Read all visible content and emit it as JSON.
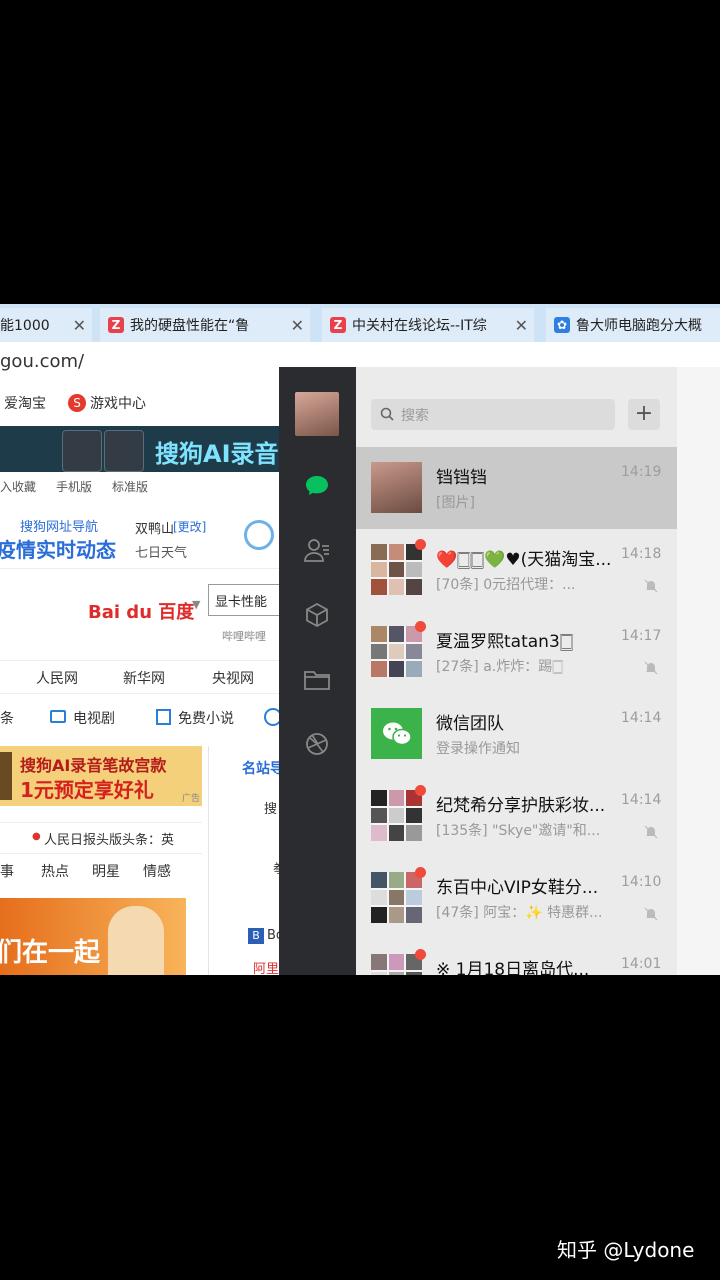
{
  "browser": {
    "tabs": [
      {
        "label": "能1000",
        "icon": "ie-tab-icon"
      },
      {
        "label": "我的硬盘性能在“鲁",
        "icon": "z-logo-icon"
      },
      {
        "label": "中关村在线论坛--IT综",
        "icon": "z-logo-icon"
      },
      {
        "label": "鲁大师电脑跑分大概",
        "icon": "paw-logo-icon"
      }
    ],
    "url": "gou.com/"
  },
  "webpage": {
    "top_links": [
      "爱淘宝",
      "游戏中心"
    ],
    "banner_text": "搜狗AI录音",
    "sub_links": [
      "加入收藏",
      "手机版",
      "标准版"
    ],
    "news_nav_label": "搜狗网址导航",
    "news_headline": "疫情实时动态",
    "weather_city": "双鸭山",
    "weather_change": "[更改]",
    "weather_label": "七日天气",
    "baidu_logo": "Bai du 百度",
    "search_value": "显卡性能",
    "search_hint": "哔哩哔哩",
    "site_links": [
      "人民网",
      "新华网",
      "央视网"
    ],
    "categories": [
      "条",
      "电视剧",
      "免费小说"
    ],
    "ad_line1": "搜狗AI录音笔故宫款",
    "ad_line2": "1元预定享好礼",
    "ad_tag": "广告",
    "right_tab": "名站导",
    "right_text": [
      "搜",
      "拳"
    ],
    "headline_ticker": "人民日报头版头条：英",
    "topic_tabs": [
      "军事",
      "热点",
      "明星",
      "情感"
    ],
    "image_caption": "们在一起",
    "right_items": [
      "Bo",
      "阿里"
    ]
  },
  "wechat": {
    "search_placeholder": "搜索",
    "add_label": "+",
    "chats": [
      {
        "name": "铛铛铛",
        "preview": "[图片]",
        "time": "14:19",
        "selected": true,
        "muted": false,
        "unread": false
      },
      {
        "name": "❤️🀆🀆💚♥(天猫淘宝...",
        "preview": "[70条] 0元招代理：...",
        "time": "14:18",
        "selected": false,
        "muted": true,
        "unread": true
      },
      {
        "name": "夏温罗熙tatan3🀆",
        "preview": "[27条] a.炸炸：踢🀆",
        "time": "14:17",
        "selected": false,
        "muted": true,
        "unread": true
      },
      {
        "name": "微信团队",
        "preview": "登录操作通知",
        "time": "14:14",
        "selected": false,
        "muted": false,
        "unread": false
      },
      {
        "name": "纪梵希分享护肤彩妆...",
        "preview": "[135条] \"Skye\"邀请\"和...",
        "time": "14:14",
        "selected": false,
        "muted": true,
        "unread": true
      },
      {
        "name": "东百中心VIP女鞋分...",
        "preview": "[47条] 阿宝：✨ 特惠群...",
        "time": "14:10",
        "selected": false,
        "muted": true,
        "unread": true
      },
      {
        "name": "※ 1月18日离岛代...",
        "preview": "",
        "time": "14:01",
        "selected": false,
        "muted": false,
        "unread": true
      }
    ]
  },
  "watermark": "知乎 @Lydone"
}
